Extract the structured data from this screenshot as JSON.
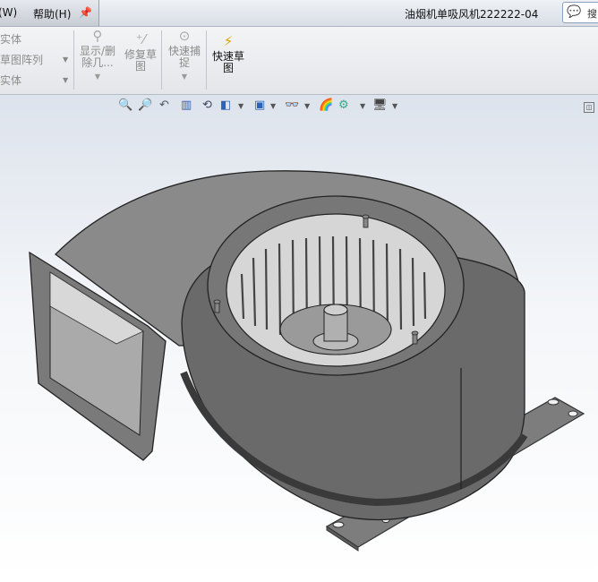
{
  "menu": {
    "item1": "(W)",
    "item2": "帮助(H)"
  },
  "window_title": "油烟机单吸风机222222-04",
  "search": {
    "label": "搜"
  },
  "ribbon": {
    "list": [
      "实体",
      "草图阵列",
      "实体"
    ],
    "show_delete": "显示/删除几...",
    "repair_sketch": "修复草图",
    "quick_snap": "快速捕捉",
    "quick_sketch": "快速草图"
  }
}
